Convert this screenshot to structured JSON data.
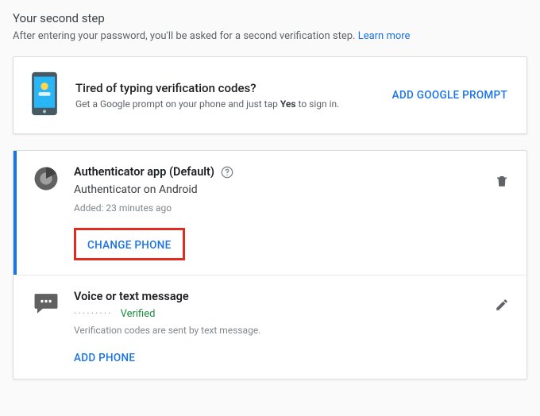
{
  "header": {
    "title": "Your second step",
    "description": "After entering your password, you'll be asked for a second verification step. ",
    "learn_more": "Learn more"
  },
  "promo": {
    "title": "Tired of typing verification codes?",
    "description_pre": "Get a Google prompt on your phone and just tap ",
    "description_bold": "Yes",
    "description_post": " to sign in.",
    "action": "ADD GOOGLE PROMPT"
  },
  "methods": [
    {
      "title": "Authenticator app (Default)",
      "subtitle": "Authenticator on Android",
      "added": "Added: 23 minutes ago",
      "action": "CHANGE PHONE"
    },
    {
      "title": "Voice or text message",
      "verified_dash": "·········",
      "verified": "Verified",
      "description": "Verification codes are sent by text message.",
      "action": "ADD PHONE"
    }
  ]
}
